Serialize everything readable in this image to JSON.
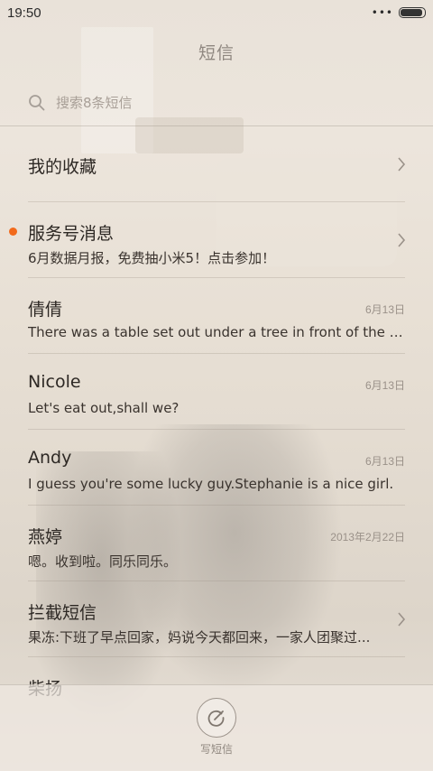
{
  "status_bar": {
    "time": "19:50",
    "dots": "•••"
  },
  "header": {
    "title": "短信"
  },
  "search": {
    "placeholder": "搜索8条短信"
  },
  "conversations": [
    {
      "name": "我的收藏",
      "preview": "",
      "date": "",
      "unread": false,
      "chevron": true
    },
    {
      "name": "服务号消息",
      "preview": "6月数据月报，免费抽小米5！点击参加！",
      "date": "",
      "unread": true,
      "chevron": true
    },
    {
      "name": "倩倩",
      "preview": "There was a table set out under a tree in front of the ho...",
      "date": "6月13日",
      "unread": false,
      "chevron": false
    },
    {
      "name": "Nicole",
      "preview": "Let's eat out,shall we?",
      "date": "6月13日",
      "unread": false,
      "chevron": false
    },
    {
      "name": "Andy",
      "preview": "I guess you're some lucky guy.Stephanie is a nice girl.",
      "date": "6月13日",
      "unread": false,
      "chevron": false
    },
    {
      "name": "燕婷",
      "preview": "嗯。收到啦。同乐同乐。",
      "date": "2013年2月22日",
      "unread": false,
      "chevron": false
    },
    {
      "name": "拦截短信",
      "preview": "果冻:下班了早点回家，妈说今天都回来，一家人团聚过...",
      "date": "",
      "unread": false,
      "chevron": true
    },
    {
      "name": "柴扬",
      "preview": "",
      "date": "",
      "unread": false,
      "chevron": false
    }
  ],
  "bottom_bar": {
    "compose_label": "写短信"
  },
  "colors": {
    "unread_dot": "#f26a1b",
    "background": "#e9e2d9"
  }
}
